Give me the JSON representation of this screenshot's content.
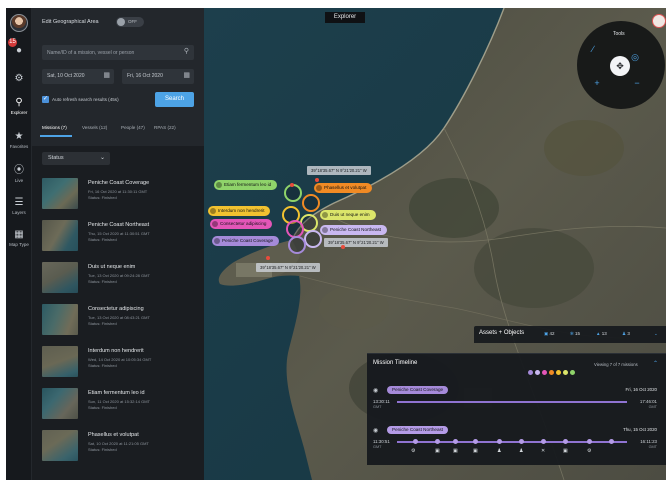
{
  "window": {
    "title": "Explorer"
  },
  "rail": {
    "notification_count": "15",
    "items": [
      {
        "label": ""
      },
      {
        "label": "Explorer"
      },
      {
        "label": "Favorites"
      },
      {
        "label": "Live"
      },
      {
        "label": "Layers"
      },
      {
        "label": "Map Type"
      }
    ]
  },
  "panel": {
    "geo_title": "Edit Geographical Area",
    "geo_toggle": "OFF",
    "search_placeholder": "Name/ID of a mission, vessel or person",
    "date_from": "Sat, 10 Oct 2020",
    "date_to": "Fri, 16 Oct 2020",
    "auto_refresh": "Auto refresh search results (45s)",
    "search_button": "Search",
    "tabs": [
      {
        "label": "Missions (7)"
      },
      {
        "label": "Vessels (12)"
      },
      {
        "label": "People (47)"
      },
      {
        "label": "RPAS (22)"
      }
    ],
    "status_filter": "Status",
    "missions": [
      {
        "title": "Peniche Coast Coverage",
        "date": "Fri, 16 Oct 2020 at 11:30:11 GMT",
        "status": "Status: Finished"
      },
      {
        "title": "Peniche Coast Northeast",
        "date": "Thu, 15 Oct 2020 at 11:30:51 GMT",
        "status": "Status: Finished"
      },
      {
        "title": "Duis ut neque enim",
        "date": "Tue, 13 Oct 2020 at 09:24:28 GMT",
        "status": "Status: Finished"
      },
      {
        "title": "Consectetur adipiscing",
        "date": "Tue, 13 Oct 2020 at 08:43:21 GMT",
        "status": "Status: Finished"
      },
      {
        "title": "Interdum non hendrerit",
        "date": "Wed, 14 Oct 2020 at 10:05:34 GMT",
        "status": "Status: Finished"
      },
      {
        "title": "Etiam fermentum leo id",
        "date": "Sun, 11 Oct 2020 at 15:32:14 GMT",
        "status": "Status: Finished"
      },
      {
        "title": "Phasellus et volutpat",
        "date": "Sat, 10 Oct 2020 at 11:21:05 GMT",
        "status": "Status: Finished"
      }
    ]
  },
  "map": {
    "tools_label": "Tools",
    "tags": [
      {
        "label": "Etiam fermentum leo id",
        "color": "#8fd36a"
      },
      {
        "label": "Phasellus et volutpat",
        "color": "#f08a24"
      },
      {
        "label": "Interdum non hendrerit",
        "color": "#f2c230"
      },
      {
        "label": "Duis ut neque enim",
        "color": "#dbe56a"
      },
      {
        "label": "Consectetur adipiscing",
        "color": "#e456b8"
      },
      {
        "label": "Peniche Coast Northeast",
        "color": "#c9b8f0"
      },
      {
        "label": "Peniche Coast Coverage",
        "color": "#a58ad9"
      }
    ],
    "coords": [
      "39°18'35.67\" N 9°21'20.21\" W",
      "39°18'35.67\" N 9°21'20.21\" W",
      "39°18'35.67\" N 9°21'20.21\" W"
    ]
  },
  "assets": {
    "title": "Assets + Objects",
    "counts": [
      "42",
      "15",
      "13",
      "3"
    ]
  },
  "timeline": {
    "title": "Mission Timeline",
    "viewing": "Viewing 7 of 7 missions",
    "dot_colors": [
      "#a58ad9",
      "#c9b8f0",
      "#e456b8",
      "#f08a24",
      "#f2c230",
      "#dbe56a",
      "#8fd36a"
    ],
    "rows": [
      {
        "name": "Peniche Coast Coverage",
        "date": "Fri, 16 Oct 2020",
        "start": "13:30:11",
        "end": "17:46:01",
        "tz": "GMT"
      },
      {
        "name": "Peniche Coast Northeast",
        "date": "Thu, 15 Oct 2020",
        "start": "11:30:51",
        "end": "16:11:23",
        "tz": "GMT"
      }
    ]
  }
}
